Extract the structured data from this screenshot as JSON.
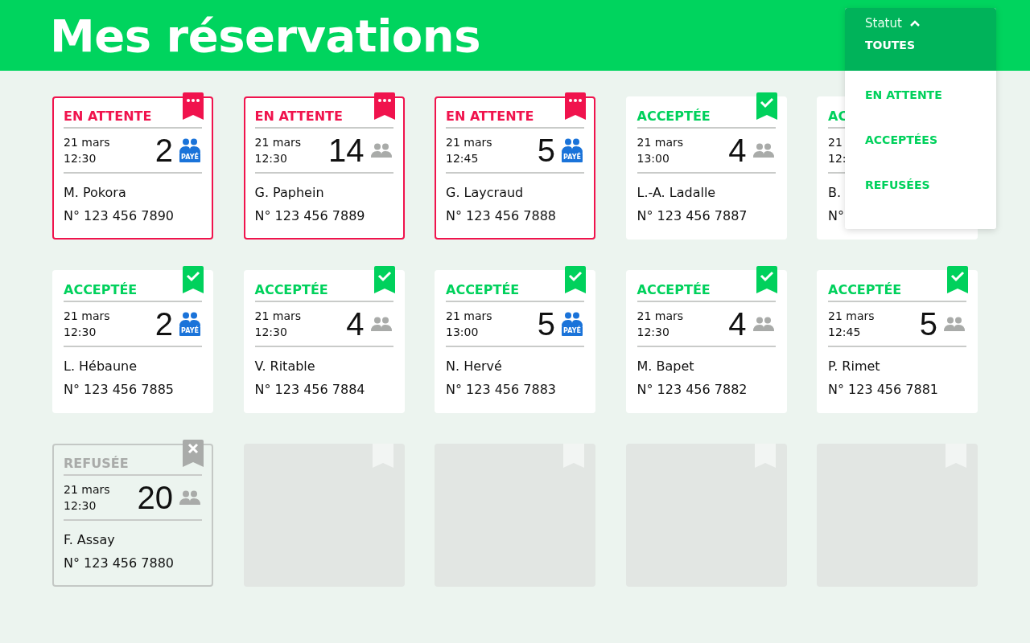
{
  "header": {
    "title": "Mes réservations"
  },
  "filter": {
    "label": "Statut",
    "expanded": true,
    "options": [
      {
        "label": "TOUTES",
        "selected": true
      },
      {
        "label": "EN ATTENTE",
        "selected": false
      },
      {
        "label": "ACCEPTÉES",
        "selected": false
      },
      {
        "label": "REFUSÉES",
        "selected": false
      }
    ]
  },
  "cards": [
    {
      "kind": "pending",
      "status": "EN ATTENTE",
      "date": "21 mars",
      "time": "12:30",
      "count": "2",
      "paid": true,
      "badge": "PAYÉ",
      "name": "M. Pokora",
      "number": "N° 123 456 7890"
    },
    {
      "kind": "pending",
      "status": "EN ATTENTE",
      "date": "21 mars",
      "time": "12:30",
      "count": "14",
      "paid": false,
      "name": "G. Paphein",
      "number": "N° 123 456 7889"
    },
    {
      "kind": "pending",
      "status": "EN ATTENTE",
      "date": "21 mars",
      "time": "12:45",
      "count": "5",
      "paid": true,
      "badge": "PAYÉ",
      "name": "G. Laycraud",
      "number": "N° 123 456 7888"
    },
    {
      "kind": "accepted",
      "status": "ACCEPTÉE",
      "date": "21 mars",
      "time": "13:00",
      "count": "4",
      "paid": false,
      "name": "L.-A. Ladalle",
      "number": "N° 123 456 7887"
    },
    {
      "kind": "accepted",
      "covered": true,
      "status": "AC",
      "date": "21",
      "time": "12:",
      "name": "B.",
      "number": "N°"
    },
    {
      "kind": "accepted",
      "status": "ACCEPTÉE",
      "date": "21 mars",
      "time": "12:30",
      "count": "2",
      "paid": true,
      "badge": "PAYÉ",
      "name": "L. Hébaune",
      "number": "N° 123 456 7885"
    },
    {
      "kind": "accepted",
      "status": "ACCEPTÉE",
      "date": "21 mars",
      "time": "12:30",
      "count": "4",
      "paid": false,
      "name": "V. Ritable",
      "number": "N° 123 456 7884"
    },
    {
      "kind": "accepted",
      "status": "ACCEPTÉE",
      "date": "21 mars",
      "time": "13:00",
      "count": "5",
      "paid": true,
      "badge": "PAYÉ",
      "name": "N. Hervé",
      "number": "N° 123 456 7883"
    },
    {
      "kind": "accepted",
      "status": "ACCEPTÉE",
      "date": "21 mars",
      "time": "12:30",
      "count": "4",
      "paid": false,
      "name": "M. Bapet",
      "number": "N° 123 456 7882"
    },
    {
      "kind": "accepted",
      "status": "ACCEPTÉE",
      "date": "21 mars",
      "time": "12:45",
      "count": "5",
      "paid": false,
      "name": "P. Rimet",
      "number": "N° 123 456 7881"
    },
    {
      "kind": "refused",
      "status": "REFUSÉE",
      "date": "21 mars",
      "time": "12:30",
      "count": "20",
      "paid": false,
      "name": "F. Assay",
      "number": "N° 123 456 7880"
    },
    {
      "kind": "empty"
    },
    {
      "kind": "empty"
    },
    {
      "kind": "empty"
    },
    {
      "kind": "empty"
    }
  ]
}
